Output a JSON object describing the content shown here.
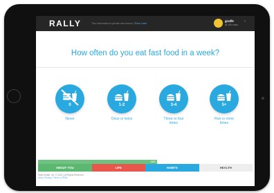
{
  "header": {
    "logo": "RALLY",
    "notice_text": "This information is private and secure | ",
    "notice_link": "Rock Later",
    "user_name": "giraffe",
    "user_sub": "@ 150 coins",
    "caret": "⌄"
  },
  "question": "How often do you eat fast food in a week?",
  "options": [
    {
      "number": "0",
      "label": "Never",
      "label2": ""
    },
    {
      "number": "1-2",
      "label": "Once or twice",
      "label2": ""
    },
    {
      "number": "3-4",
      "label": "Three or four",
      "label2": "times"
    },
    {
      "number": "5+",
      "label": "Five or more",
      "label2": "times"
    }
  ],
  "progress": {
    "percent_text": "58%",
    "fraction": 0.58
  },
  "tabs": [
    {
      "label": "ABOUT YOU",
      "color": "#5cb870",
      "text_color": "#ffffff"
    },
    {
      "label": "LIFE",
      "color": "#e9564c",
      "text_color": "#ffffff"
    },
    {
      "label": "HABITS",
      "color": "#29a9e0",
      "text_color": "#ffffff"
    },
    {
      "label": "HEALTH",
      "color": "#eeeeee",
      "text_color": "#555555"
    }
  ],
  "footer": {
    "copyright": "Rally Health, Inc. © 2014  |  All Rights Reserved",
    "links": "Help | Privacy | Terms | HIPAA"
  },
  "colors": {
    "accent": "#29a9e0",
    "brand_red": "#e74c3c",
    "topbar": "#262626"
  },
  "icons": [
    "crossed-food-icon",
    "fast-food-icon"
  ]
}
